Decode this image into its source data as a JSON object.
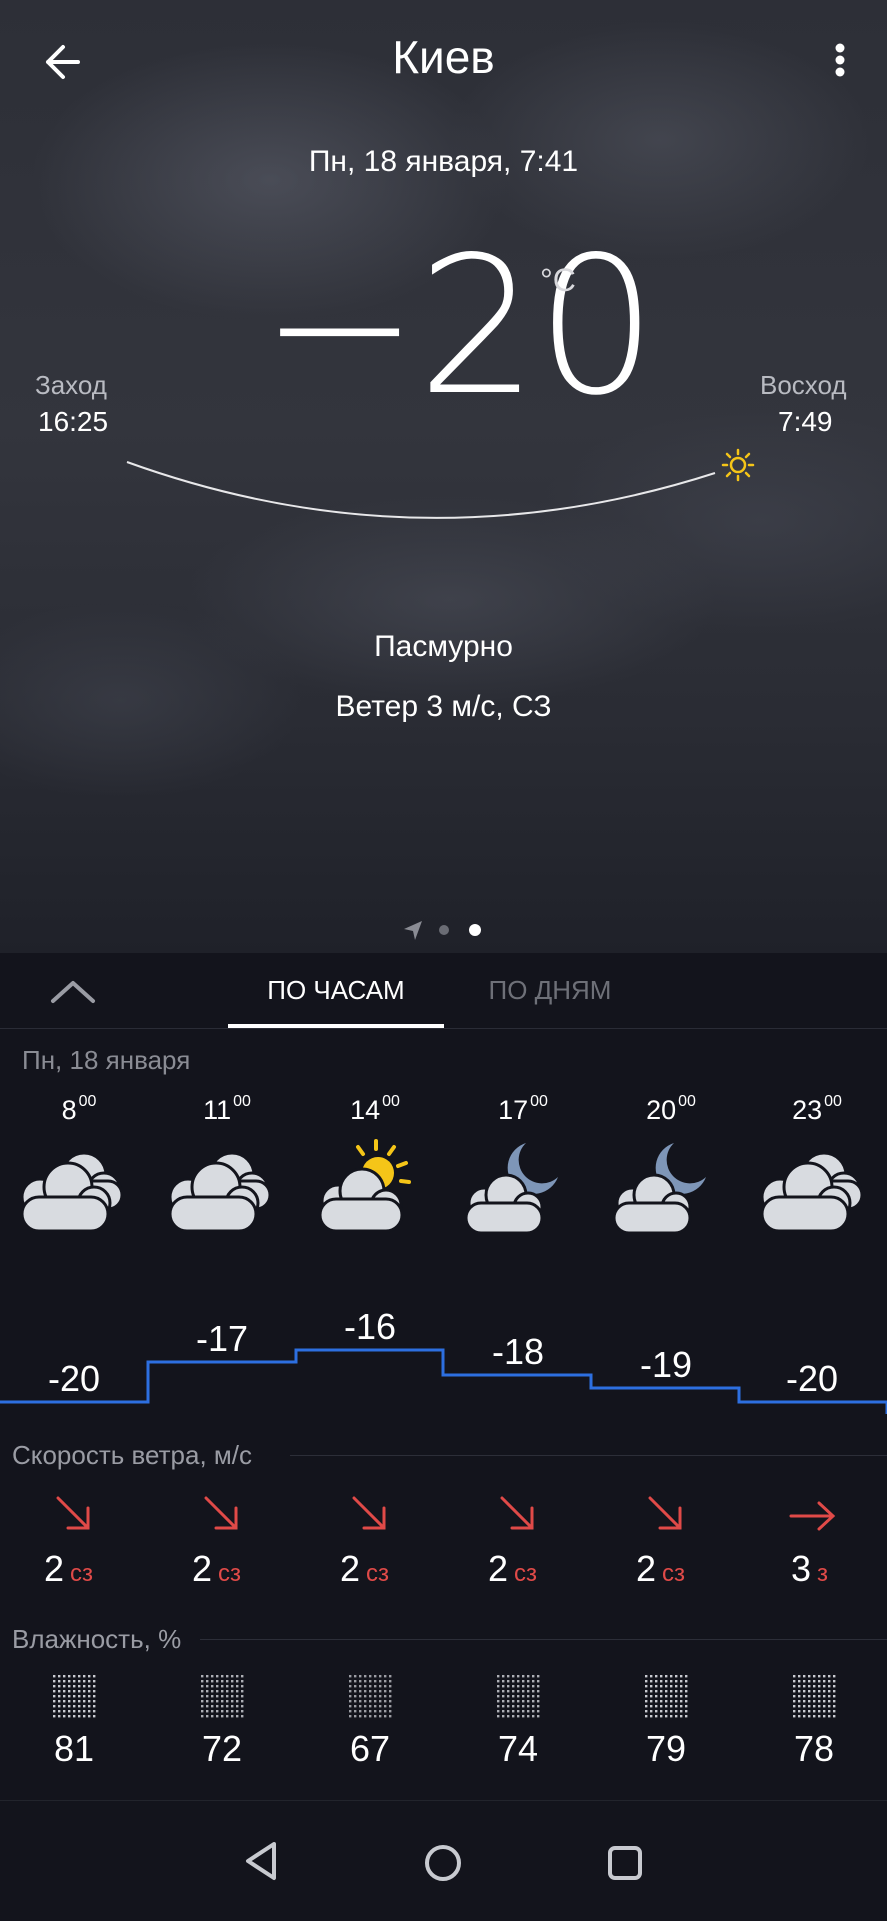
{
  "header": {
    "city": "Киев",
    "back_icon": "arrow-left-icon",
    "menu_icon": "more-vert-icon"
  },
  "date_time": "Пн, 18 января, 7:41",
  "current": {
    "temperature": "−20",
    "unit": "°C",
    "condition": "Пасмурно",
    "wind": "Ветер 3 м/с, СЗ",
    "sunset_label": "Заход",
    "sunset_time": "16:25",
    "sunrise_label": "Восход",
    "sunrise_time": "7:49"
  },
  "pager": {
    "pages": 3,
    "active": 2
  },
  "tabs": {
    "hours": "ПО ЧАСАМ",
    "days": "ПО ДНЯМ",
    "active": "hours"
  },
  "day_label": "Пн, 18 января",
  "hourly": [
    {
      "hour": "8",
      "min": "00",
      "icon": "cloudy-icon",
      "temp": "-20",
      "wind_speed": "2",
      "wind_dir": "сз",
      "humidity": "81"
    },
    {
      "hour": "11",
      "min": "00",
      "icon": "cloudy-icon",
      "temp": "-17",
      "wind_speed": "2",
      "wind_dir": "сз",
      "humidity": "72"
    },
    {
      "hour": "14",
      "min": "00",
      "icon": "partly-sunny-icon",
      "temp": "-16",
      "wind_speed": "2",
      "wind_dir": "сз",
      "humidity": "67"
    },
    {
      "hour": "17",
      "min": "00",
      "icon": "cloudy-night-icon",
      "temp": "-18",
      "wind_speed": "2",
      "wind_dir": "сз",
      "humidity": "74"
    },
    {
      "hour": "20",
      "min": "00",
      "icon": "cloudy-night-icon",
      "temp": "-19",
      "wind_speed": "2",
      "wind_dir": "сз",
      "humidity": "79"
    },
    {
      "hour": "23",
      "min": "00",
      "icon": "cloudy-icon",
      "temp": "-20",
      "wind_speed": "3",
      "wind_dir": "з",
      "humidity": "78"
    }
  ],
  "labels": {
    "wind_speed": "Скорость ветра, м/с",
    "humidity": "Влажность, %"
  },
  "colors": {
    "accent_line": "#2d6fe0",
    "wind_arrow": "#e04a48",
    "sun": "#f5c518",
    "moon": "#7e96b8"
  },
  "navbar": {
    "back_icon": "nav-back-icon",
    "home_icon": "nav-home-icon",
    "recents_icon": "nav-recents-icon"
  }
}
